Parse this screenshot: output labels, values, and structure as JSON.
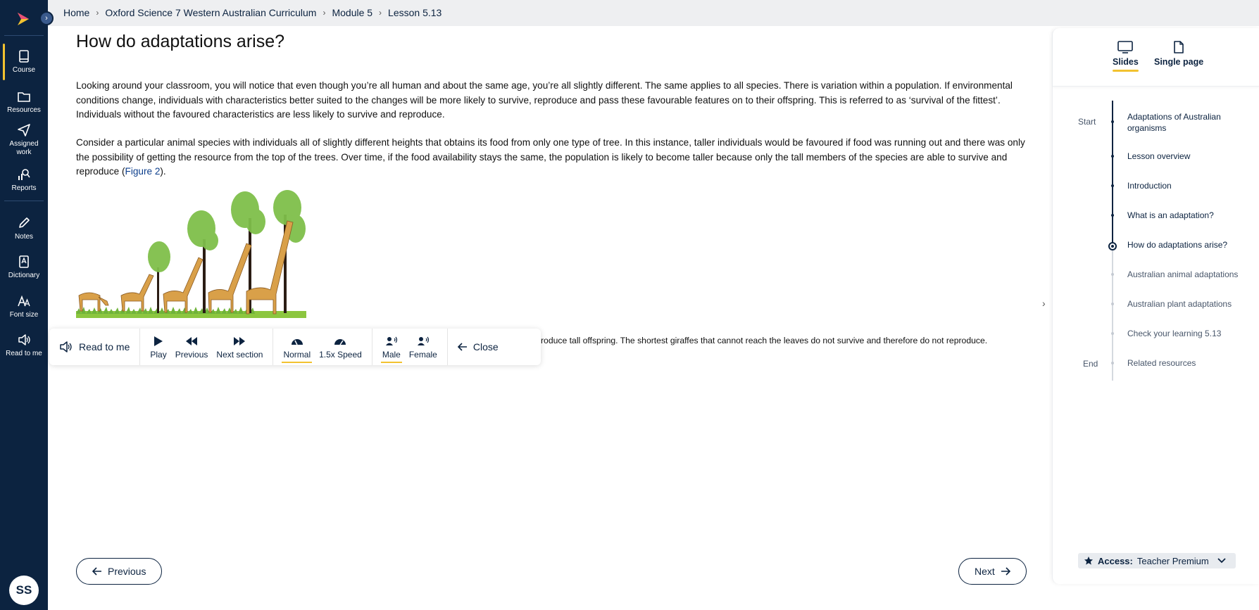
{
  "sidebar": {
    "items": [
      {
        "label": "Course",
        "icon": "book-icon"
      },
      {
        "label": "Resources",
        "icon": "folder-icon"
      },
      {
        "label": "Assigned work",
        "icon": "send-icon"
      },
      {
        "label": "Reports",
        "icon": "reports-icon"
      },
      {
        "label": "Notes",
        "icon": "pencil-icon"
      },
      {
        "label": "Dictionary",
        "icon": "dictionary-icon"
      },
      {
        "label": "Font size",
        "icon": "font-size-icon"
      },
      {
        "label": "Read to me",
        "icon": "speaker-icon"
      }
    ],
    "avatar_initials": "SS",
    "accent_color": "#f2c230",
    "bg_color": "#0c2340"
  },
  "breadcrumb": {
    "items": [
      "Home",
      "Oxford Science 7 Western Australian Curriculum",
      "Module 5",
      "Lesson 5.13"
    ]
  },
  "main": {
    "title": "How do adaptations arise?",
    "para1": "Looking around your classroom, you will notice that even though you’re all human and about the same age, you’re all slightly different. The same applies to all species. There is variation within a population. If environmental conditions change, individuals with characteristics better suited to the changes will be more likely to survive, reproduce and pass these favourable features on to their offspring. This is referred to as ‘survival of the fittest’. Individuals without the favoured characteristics are less likely to survive and reproduce.",
    "para2_text": "Consider a particular animal species with individuals all of slightly different heights that obtains its food from only one type of tree. In this instance, taller individuals would be favoured if food was running out and there was only the possibility of getting the resource from the top of the trees. Over time, if the food availability stays the same, the population is likely to become taller because only the tall members of the species are able to survive and reproduce (",
    "para2_link": "Figure 2",
    "para2_end": ").",
    "caption_visible": "roduce tall offspring. The shortest giraffes that cannot reach the leaves do not survive and therefore do not reproduce."
  },
  "read_to_me": {
    "label": "Read to me",
    "play": "Play",
    "previous": "Previous",
    "next_section": "Next section",
    "normal": "Normal",
    "speed": "1.5x Speed",
    "male": "Male",
    "female": "Female",
    "close": "Close"
  },
  "nav": {
    "previous": "Previous",
    "next": "Next"
  },
  "right_panel": {
    "tabs": [
      {
        "label": "Slides",
        "icon": "monitor-icon",
        "selected": true
      },
      {
        "label": "Single page",
        "icon": "page-icon",
        "selected": false
      }
    ],
    "start_label": "Start",
    "end_label": "End",
    "timeline": [
      {
        "label": "Adaptations of Australian organisms",
        "state": "done"
      },
      {
        "label": "Lesson overview",
        "state": "done"
      },
      {
        "label": "Introduction",
        "state": "done"
      },
      {
        "label": "What is an adaptation?",
        "state": "done"
      },
      {
        "label": "How do adaptations arise?",
        "state": "current"
      },
      {
        "label": "Australian animal adaptations",
        "state": "todo"
      },
      {
        "label": "Australian plant adaptations",
        "state": "todo"
      },
      {
        "label": "Check your learning 5.13",
        "state": "todo"
      },
      {
        "label": "Related resources",
        "state": "todo"
      }
    ],
    "access_label": "Access:",
    "access_value": "Teacher Premium"
  }
}
